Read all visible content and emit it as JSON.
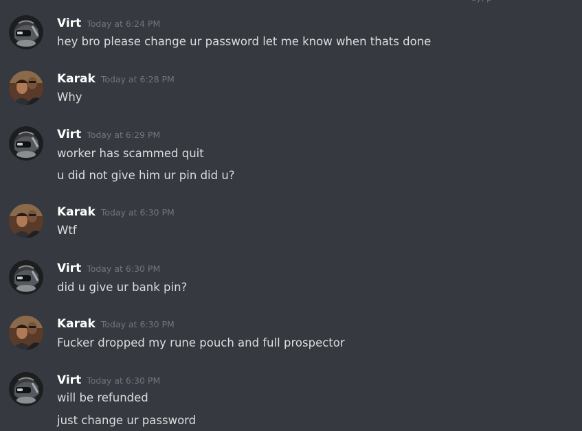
{
  "messages": [
    {
      "author": "Virt",
      "timestamp": "Today at 6:24 PM",
      "lines": [
        "hey bro please change ur password let me know when thats done"
      ]
    },
    {
      "author": "Karak",
      "timestamp": "Today at 6:28 PM",
      "lines": [
        "Why"
      ]
    },
    {
      "author": "Virt",
      "timestamp": "Today at 6:29 PM",
      "lines": [
        "worker has scammed quit",
        "u did not give him ur pin did u?"
      ]
    },
    {
      "author": "Karak",
      "timestamp": "Today at 6:30 PM",
      "lines": [
        "Wtf"
      ]
    },
    {
      "author": "Virt",
      "timestamp": "Today at 6:30 PM",
      "lines": [
        "did u give ur bank pin?"
      ]
    },
    {
      "author": "Karak",
      "timestamp": "Today at 6:30 PM",
      "lines": [
        "Fucker dropped my rune pouch and full prospector"
      ]
    },
    {
      "author": "Virt",
      "timestamp": "Today at 6:30 PM",
      "lines": [
        "will be refunded",
        "just change ur password"
      ]
    }
  ],
  "colors": {
    "background": "#36393f",
    "username": "#ffffff",
    "message_text": "#dcddde",
    "timestamp": "#72767d"
  },
  "avatars": {
    "Virt": "helmet-avatar-icon",
    "Karak": "photo-avatar"
  }
}
